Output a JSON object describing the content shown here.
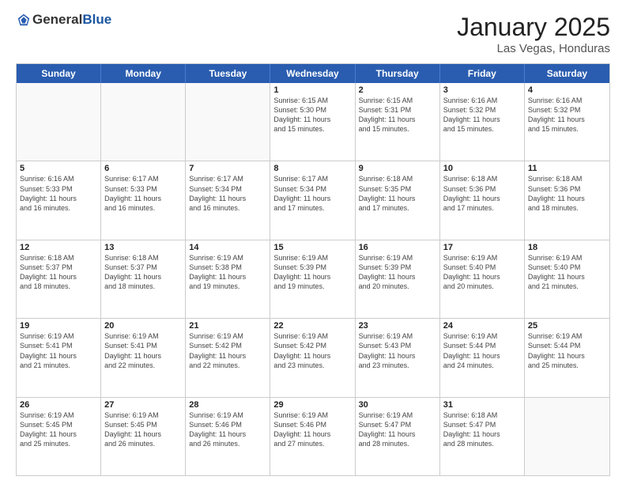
{
  "header": {
    "logo": {
      "general": "General",
      "blue": "Blue"
    },
    "title": "January 2025",
    "subtitle": "Las Vegas, Honduras"
  },
  "weekdays": [
    "Sunday",
    "Monday",
    "Tuesday",
    "Wednesday",
    "Thursday",
    "Friday",
    "Saturday"
  ],
  "rows": [
    [
      {
        "day": "",
        "empty": true
      },
      {
        "day": "",
        "empty": true
      },
      {
        "day": "",
        "empty": true
      },
      {
        "day": "1",
        "sunrise": "6:15 AM",
        "sunset": "5:30 PM",
        "daylight": "11 hours and 15 minutes."
      },
      {
        "day": "2",
        "sunrise": "6:15 AM",
        "sunset": "5:31 PM",
        "daylight": "11 hours and 15 minutes."
      },
      {
        "day": "3",
        "sunrise": "6:16 AM",
        "sunset": "5:32 PM",
        "daylight": "11 hours and 15 minutes."
      },
      {
        "day": "4",
        "sunrise": "6:16 AM",
        "sunset": "5:32 PM",
        "daylight": "11 hours and 15 minutes."
      }
    ],
    [
      {
        "day": "5",
        "sunrise": "6:16 AM",
        "sunset": "5:33 PM",
        "daylight": "11 hours and 16 minutes."
      },
      {
        "day": "6",
        "sunrise": "6:17 AM",
        "sunset": "5:33 PM",
        "daylight": "11 hours and 16 minutes."
      },
      {
        "day": "7",
        "sunrise": "6:17 AM",
        "sunset": "5:34 PM",
        "daylight": "11 hours and 16 minutes."
      },
      {
        "day": "8",
        "sunrise": "6:17 AM",
        "sunset": "5:34 PM",
        "daylight": "11 hours and 17 minutes."
      },
      {
        "day": "9",
        "sunrise": "6:18 AM",
        "sunset": "5:35 PM",
        "daylight": "11 hours and 17 minutes."
      },
      {
        "day": "10",
        "sunrise": "6:18 AM",
        "sunset": "5:36 PM",
        "daylight": "11 hours and 17 minutes."
      },
      {
        "day": "11",
        "sunrise": "6:18 AM",
        "sunset": "5:36 PM",
        "daylight": "11 hours and 18 minutes."
      }
    ],
    [
      {
        "day": "12",
        "sunrise": "6:18 AM",
        "sunset": "5:37 PM",
        "daylight": "11 hours and 18 minutes."
      },
      {
        "day": "13",
        "sunrise": "6:18 AM",
        "sunset": "5:37 PM",
        "daylight": "11 hours and 18 minutes."
      },
      {
        "day": "14",
        "sunrise": "6:19 AM",
        "sunset": "5:38 PM",
        "daylight": "11 hours and 19 minutes."
      },
      {
        "day": "15",
        "sunrise": "6:19 AM",
        "sunset": "5:39 PM",
        "daylight": "11 hours and 19 minutes."
      },
      {
        "day": "16",
        "sunrise": "6:19 AM",
        "sunset": "5:39 PM",
        "daylight": "11 hours and 20 minutes."
      },
      {
        "day": "17",
        "sunrise": "6:19 AM",
        "sunset": "5:40 PM",
        "daylight": "11 hours and 20 minutes."
      },
      {
        "day": "18",
        "sunrise": "6:19 AM",
        "sunset": "5:40 PM",
        "daylight": "11 hours and 21 minutes."
      }
    ],
    [
      {
        "day": "19",
        "sunrise": "6:19 AM",
        "sunset": "5:41 PM",
        "daylight": "11 hours and 21 minutes."
      },
      {
        "day": "20",
        "sunrise": "6:19 AM",
        "sunset": "5:41 PM",
        "daylight": "11 hours and 22 minutes."
      },
      {
        "day": "21",
        "sunrise": "6:19 AM",
        "sunset": "5:42 PM",
        "daylight": "11 hours and 22 minutes."
      },
      {
        "day": "22",
        "sunrise": "6:19 AM",
        "sunset": "5:42 PM",
        "daylight": "11 hours and 23 minutes."
      },
      {
        "day": "23",
        "sunrise": "6:19 AM",
        "sunset": "5:43 PM",
        "daylight": "11 hours and 23 minutes."
      },
      {
        "day": "24",
        "sunrise": "6:19 AM",
        "sunset": "5:44 PM",
        "daylight": "11 hours and 24 minutes."
      },
      {
        "day": "25",
        "sunrise": "6:19 AM",
        "sunset": "5:44 PM",
        "daylight": "11 hours and 25 minutes."
      }
    ],
    [
      {
        "day": "26",
        "sunrise": "6:19 AM",
        "sunset": "5:45 PM",
        "daylight": "11 hours and 25 minutes."
      },
      {
        "day": "27",
        "sunrise": "6:19 AM",
        "sunset": "5:45 PM",
        "daylight": "11 hours and 26 minutes."
      },
      {
        "day": "28",
        "sunrise": "6:19 AM",
        "sunset": "5:46 PM",
        "daylight": "11 hours and 26 minutes."
      },
      {
        "day": "29",
        "sunrise": "6:19 AM",
        "sunset": "5:46 PM",
        "daylight": "11 hours and 27 minutes."
      },
      {
        "day": "30",
        "sunrise": "6:19 AM",
        "sunset": "5:47 PM",
        "daylight": "11 hours and 28 minutes."
      },
      {
        "day": "31",
        "sunrise": "6:18 AM",
        "sunset": "5:47 PM",
        "daylight": "11 hours and 28 minutes."
      },
      {
        "day": "",
        "empty": true
      }
    ]
  ],
  "labels": {
    "sunrise": "Sunrise:",
    "sunset": "Sunset:",
    "daylight": "Daylight hours"
  }
}
